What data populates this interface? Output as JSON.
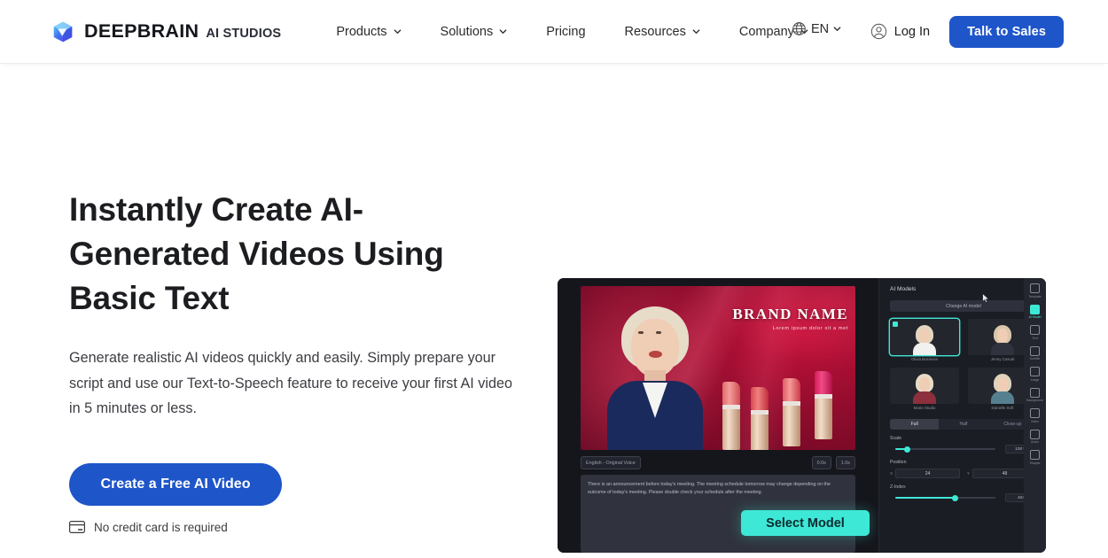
{
  "header": {
    "logo": {
      "icon": "cube-logo-icon",
      "main": "DEEPBRAIN",
      "sub": "AI STUDIOS"
    },
    "nav": [
      {
        "label": "Products",
        "has_dropdown": true
      },
      {
        "label": "Solutions",
        "has_dropdown": true
      },
      {
        "label": "Pricing",
        "has_dropdown": false
      },
      {
        "label": "Resources",
        "has_dropdown": true
      },
      {
        "label": "Company",
        "has_dropdown": true
      }
    ],
    "language": {
      "icon": "globe-icon",
      "label": "EN"
    },
    "login": {
      "icon": "user-circle-icon",
      "label": "Log In"
    },
    "cta": {
      "label": "Talk to Sales",
      "color": "#1e55c9"
    }
  },
  "hero": {
    "heading": "Instantly Create AI-Generated Videos Using Basic Text",
    "paragraph": "Generate realistic AI videos quickly and easily. Simply prepare your script and use our Text-to-Speech feature to receive your first AI video in 5 minutes or less.",
    "cta": {
      "label": "Create a Free AI Video",
      "color": "#1e55c9"
    },
    "note": {
      "icon": "credit-card-icon",
      "label": "No credit card is required"
    }
  },
  "mockup": {
    "video": {
      "brand_name": "BRAND NAME",
      "brand_tagline": "Lorem ipsum dolor sit a met",
      "voice_chip": "English - Original Voice",
      "chip_duration": "0.0s",
      "chip_length": "1.0s",
      "script_text": "There is an announcement before today's meeting. The meeting schedule tomorrow may change depending on the outcome of today's meeting. Please double check your schedule after the meeting."
    },
    "select_model_button": {
      "label": "Select Model",
      "color": "#3ee8d6"
    },
    "panel": {
      "title": "AI Models",
      "change_button": "Change AI model",
      "models": [
        {
          "label": "Olivia Business",
          "selected": true
        },
        {
          "label": "Jenny Casual",
          "selected": false
        },
        {
          "label": "Marie Studio",
          "selected": false
        },
        {
          "label": "Danielle Soft",
          "selected": false
        }
      ],
      "tabs": [
        {
          "label": "Full",
          "active": true
        },
        {
          "label": "Half",
          "active": false
        },
        {
          "label": "Close-up",
          "active": false
        }
      ],
      "controls": [
        {
          "name": "Scale",
          "value": "100 %"
        },
        {
          "name": "Position",
          "x": "24",
          "y": "48"
        },
        {
          "name": "Z-Index",
          "value": "404"
        }
      ]
    },
    "rail": [
      {
        "label": "Template",
        "icon": "template-icon",
        "active": false
      },
      {
        "label": "AI Model",
        "icon": "person-icon",
        "active": true
      },
      {
        "label": "Text",
        "icon": "text-icon",
        "active": false
      },
      {
        "label": "Subtitle",
        "icon": "subtitle-icon",
        "active": false
      },
      {
        "label": "Image",
        "icon": "image-icon",
        "active": false
      },
      {
        "label": "Background",
        "icon": "background-icon",
        "active": false
      },
      {
        "label": "Video",
        "icon": "video-icon",
        "active": false
      },
      {
        "label": "Audio",
        "icon": "audio-icon",
        "active": false
      },
      {
        "label": "Shapes",
        "icon": "shapes-icon",
        "active": false
      }
    ]
  }
}
